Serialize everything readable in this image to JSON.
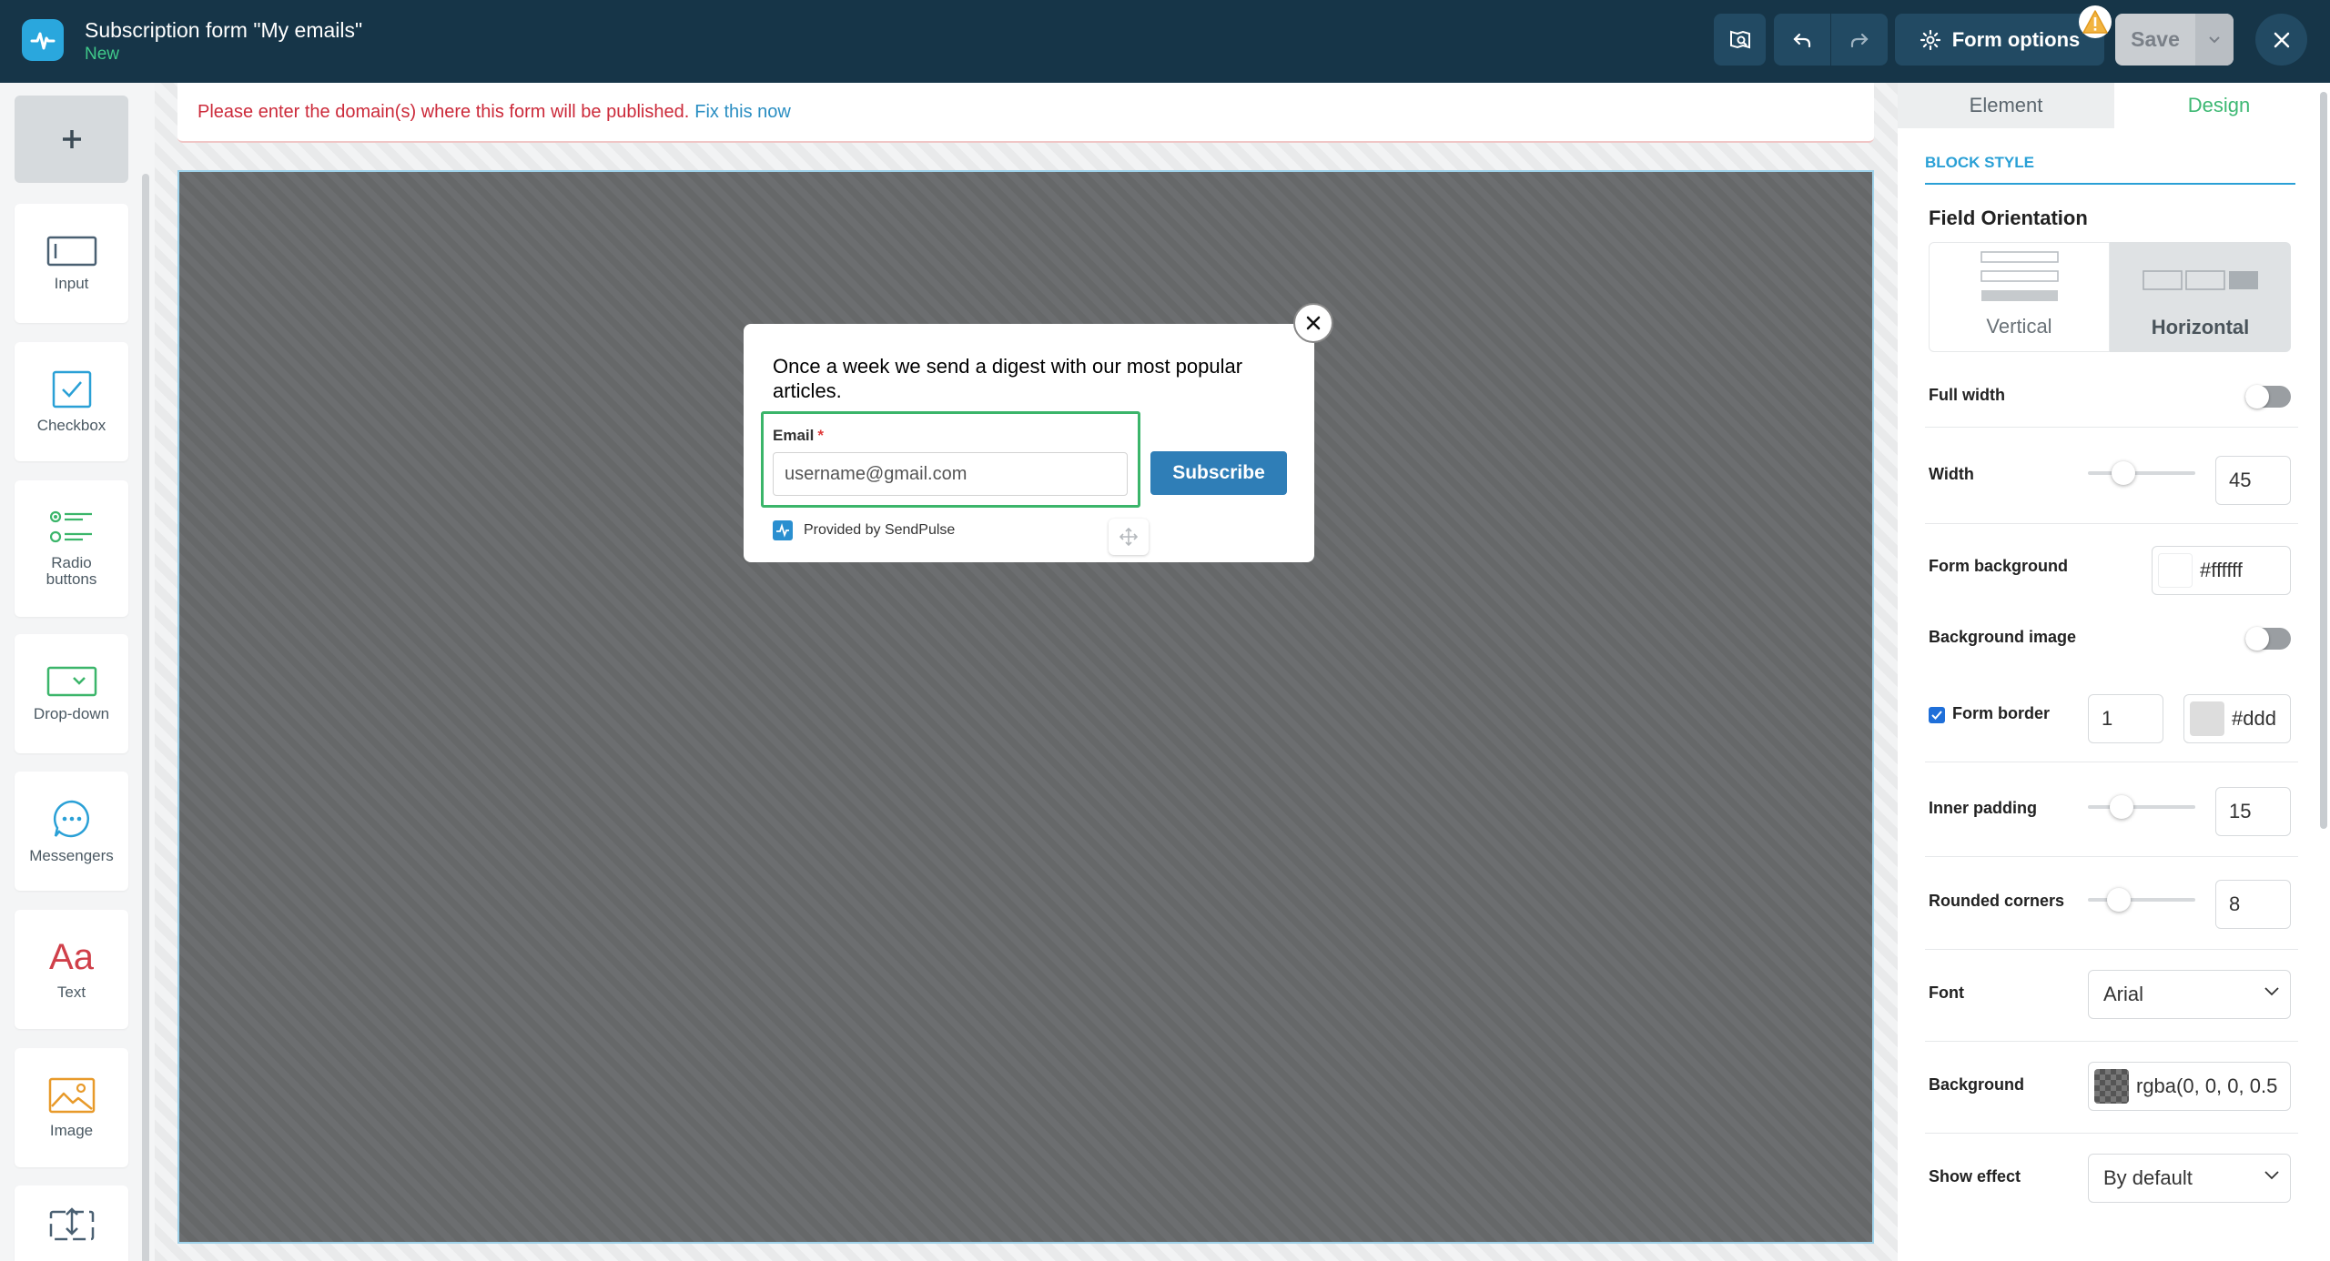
{
  "header": {
    "title": "Subscription form \"My emails\"",
    "status": "New",
    "form_options_label": "Form options",
    "save_label": "Save"
  },
  "left_sidebar": {
    "items": [
      {
        "label": "Input",
        "icon": "input-icon"
      },
      {
        "label": "Checkbox",
        "icon": "checkbox-icon"
      },
      {
        "label": "Radio buttons",
        "icon": "radio-buttons-icon"
      },
      {
        "label": "Drop-down",
        "icon": "dropdown-icon"
      },
      {
        "label": "Messengers",
        "icon": "messengers-icon"
      },
      {
        "label": "Text",
        "icon": "text-icon"
      },
      {
        "label": "Image",
        "icon": "image-icon"
      }
    ]
  },
  "alert": {
    "message": "Please enter the domain(s) where this form will be published.",
    "link": "Fix this now"
  },
  "form": {
    "text": "Once a week we send a digest with our most popular articles.",
    "email_label": "Email",
    "required_mark": "*",
    "email_placeholder": "username@gmail.com",
    "subscribe_label": "Subscribe",
    "powered_by": "Provided by SendPulse"
  },
  "panel": {
    "tabs": [
      "Element",
      "Design"
    ],
    "active_tab": "Design",
    "section": "BLOCK STYLE",
    "field_orientation": {
      "label": "Field Orientation",
      "options": [
        "Vertical",
        "Horizontal"
      ],
      "selected": "Horizontal"
    },
    "full_width": {
      "label": "Full width",
      "on": false
    },
    "width": {
      "label": "Width",
      "value": "45",
      "slider_fraction": 0.22
    },
    "form_background": {
      "label": "Form background",
      "value": "#ffffff",
      "swatch": "#ffffff"
    },
    "background_image": {
      "label": "Background image",
      "on": false
    },
    "form_border": {
      "label": "Form border",
      "checked": true,
      "width": "1",
      "color": "#ddd",
      "swatch": "#dddddd"
    },
    "inner_padding": {
      "label": "Inner padding",
      "value": "15",
      "slider_fraction": 0.2
    },
    "rounded_corners": {
      "label": "Rounded corners",
      "value": "8",
      "slider_fraction": 0.18
    },
    "font": {
      "label": "Font",
      "value": "Arial"
    },
    "background": {
      "label": "Background",
      "value": "rgba(0, 0, 0, 0.5"
    },
    "show_effect": {
      "label": "Show effect",
      "value": "By default"
    }
  },
  "colors": {
    "header_bg": "#163548",
    "accent_green": "#3db873",
    "accent_blue": "#2aa0d6",
    "subscribe_blue": "#2f7eb7",
    "alert_red": "#cc2a3a"
  }
}
